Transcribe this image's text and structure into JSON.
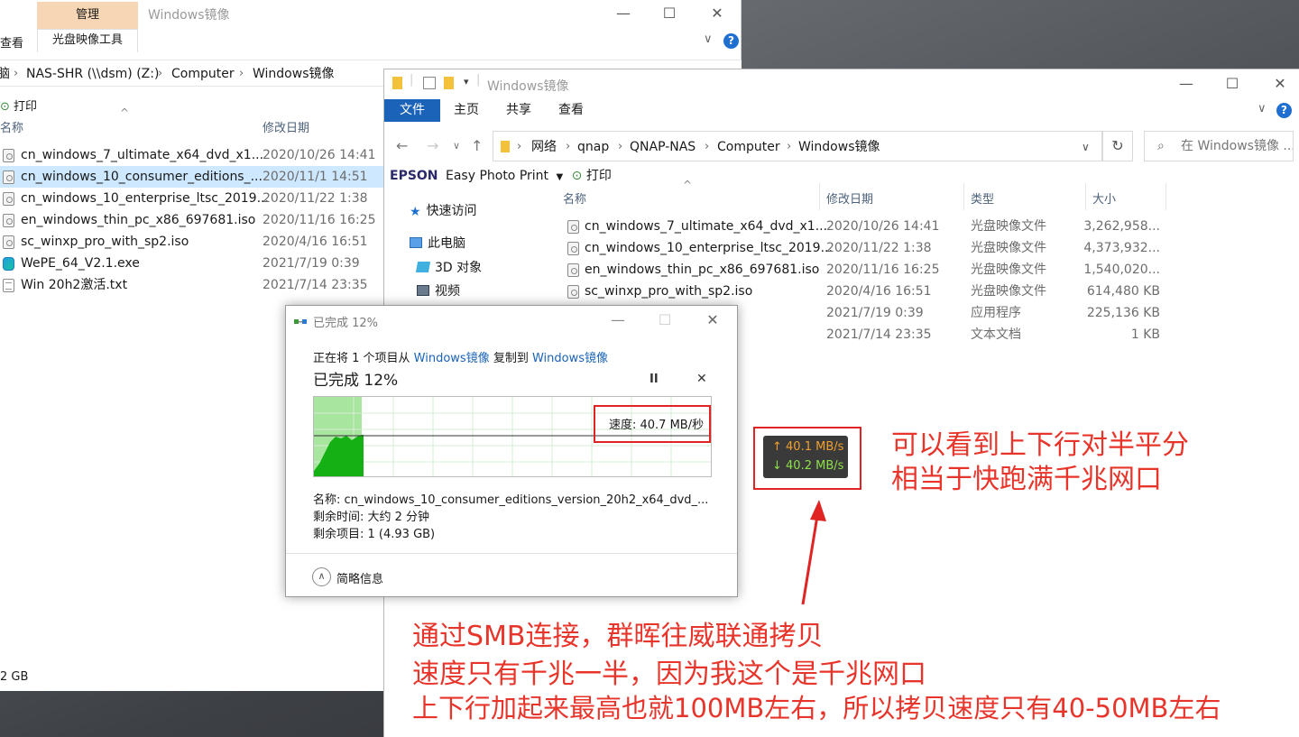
{
  "back_window": {
    "manage_tab": "管理",
    "title": "Windows镜像",
    "view_tab": "查看",
    "disc_tools_tab": "光盘映像工具",
    "breadcrumb": [
      "NAS-SHR (\\\\dsm) (Z:)",
      "Computer",
      "Windows镜像"
    ],
    "breadcrumb_lead": "脑",
    "print_label": "打印",
    "col_name": "名称",
    "col_date": "修改日期",
    "files": [
      {
        "name": "cn_windows_7_ultimate_x64_dvd_x1...",
        "date": "2020/10/26 14:41",
        "icon": "disc-image-icon"
      },
      {
        "name": "cn_windows_10_consumer_editions_...",
        "date": "2020/11/1 14:51",
        "icon": "disc-image-icon"
      },
      {
        "name": "cn_windows_10_enterprise_ltsc_2019...",
        "date": "2020/11/22 1:38",
        "icon": "disc-image-icon"
      },
      {
        "name": "en_windows_thin_pc_x86_697681.iso",
        "date": "2020/11/16 16:25",
        "icon": "disc-image-icon"
      },
      {
        "name": "sc_winxp_pro_with_sp2.iso",
        "date": "2020/4/16 16:51",
        "icon": "disc-image-icon"
      },
      {
        "name": "WePE_64_V2.1.exe",
        "date": "2021/7/19 0:39",
        "icon": "exe-icon"
      },
      {
        "name": "Win 20h2激活.txt",
        "date": "2021/7/14 23:35",
        "icon": "text-file-icon"
      }
    ],
    "status_size": "2 GB"
  },
  "front_window": {
    "title": "Windows镜像",
    "tabs": [
      "文件",
      "主页",
      "共享",
      "查看"
    ],
    "breadcrumb": [
      "网络",
      "qnap",
      "QNAP-NAS",
      "Computer",
      "Windows镜像"
    ],
    "search_placeholder": "在 Windows镜像 ...",
    "epson_brand": "EPSON",
    "epson_app": "Easy Photo Print",
    "print_label": "打印",
    "nav": [
      "快速访问",
      "此电脑",
      "3D 对象",
      "视频"
    ],
    "columns": [
      "名称",
      "修改日期",
      "类型",
      "大小"
    ],
    "files": [
      {
        "name": "cn_windows_7_ultimate_x64_dvd_x1...",
        "date": "2020/10/26 14:41",
        "type": "光盘映像文件",
        "size": "3,262,958..."
      },
      {
        "name": "cn_windows_10_enterprise_ltsc_2019...",
        "date": "2020/11/22 1:38",
        "type": "光盘映像文件",
        "size": "4,373,932..."
      },
      {
        "name": "en_windows_thin_pc_x86_697681.iso",
        "date": "2020/11/16 16:25",
        "type": "光盘映像文件",
        "size": "1,540,020..."
      },
      {
        "name": "sc_winxp_pro_with_sp2.iso",
        "date": "2020/4/16 16:51",
        "type": "光盘映像文件",
        "size": "614,480 KB"
      },
      {
        "name": "",
        "date": "2021/7/19 0:39",
        "type": "应用程序",
        "size": "225,136 KB"
      },
      {
        "name": "",
        "date": "2021/7/14 23:35",
        "type": "文本文档",
        "size": "1 KB"
      }
    ]
  },
  "copy_dialog": {
    "title": "已完成 12%",
    "desc_prefix": "正在将 1 个项目从 ",
    "source": "Windows镜像",
    "desc_mid": " 复制到 ",
    "dest": "Windows镜像",
    "progress_label": "已完成 12%",
    "progress_fraction": 0.12,
    "speed": "速度: 40.7 MB/秒",
    "name_line": "名称: cn_windows_10_consumer_editions_version_20h2_x64_dvd_...",
    "time_line": "剩余时间: 大约 2 分钟",
    "items_line": "剩余项目: 1 (4.93 GB)",
    "less_details": "简略信息",
    "pause_glyph": "II",
    "cancel_glyph": "✕"
  },
  "net_monitor": {
    "up": "↑ 40.1 MB/s",
    "down": "↓ 40.2 MB/s",
    "up_color": "#f0a030",
    "down_color": "#8ee04a"
  },
  "annotations": {
    "right_1": "可以看到上下行对半平分",
    "right_2": "相当于快跑满千兆网口",
    "bottom_1": "通过SMB连接，群晖往威联通拷贝",
    "bottom_2": "速度只有千兆一半，因为我这个是千兆网口",
    "bottom_3": "上下行加起来最高也就100MB左右，所以拷贝速度只有40-50MB左右",
    "color": "#e8352b"
  }
}
